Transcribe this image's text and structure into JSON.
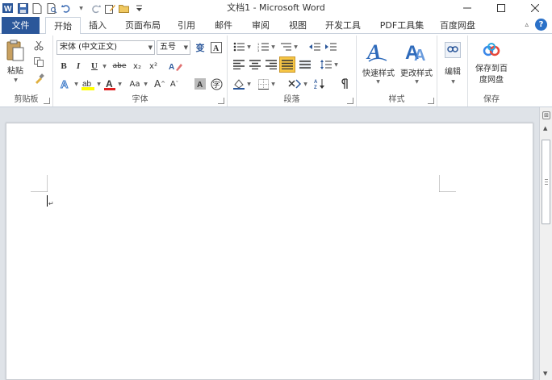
{
  "window": {
    "title": "文档1 - Microsoft Word",
    "minimize_icon": "minimize-icon",
    "maximize_icon": "maximize-icon",
    "close_icon": "close-icon"
  },
  "quick_access": {
    "icons": [
      "word-logo-icon",
      "save-icon",
      "new-document-icon",
      "print-preview-icon",
      "undo-icon",
      "redo-icon",
      "open-icon",
      "customize-icon"
    ]
  },
  "tabs": {
    "file": "文件",
    "items": [
      "开始",
      "插入",
      "页面布局",
      "引用",
      "邮件",
      "审阅",
      "视图",
      "开发工具",
      "PDF工具集",
      "百度网盘"
    ],
    "active": "开始"
  },
  "ribbon": {
    "clipboard": {
      "label": "剪贴板",
      "paste": "粘贴"
    },
    "font": {
      "label": "字体",
      "font_name": "宋体 (中文正文)",
      "font_size": "五号",
      "bold": "B",
      "italic": "I",
      "underline": "U",
      "strikethrough": "abe",
      "subscript": "x₂",
      "superscript": "x²",
      "change_case": "Aa",
      "grow_font": "A",
      "shrink_font": "A",
      "char_border": "A",
      "enclosed_char": "字"
    },
    "paragraph": {
      "label": "段落"
    },
    "styles": {
      "label": "样式",
      "quick_styles": "快速样式",
      "change_styles": "更改样式"
    },
    "editing": {
      "label": "编辑"
    },
    "save": {
      "label": "保存",
      "button": "保存到百度网盘"
    }
  },
  "colors": {
    "accent": "#2b579a",
    "highlight_yellow": "#ffff00",
    "font_color_red": "#e02020",
    "justify_active": "#f7c645"
  }
}
